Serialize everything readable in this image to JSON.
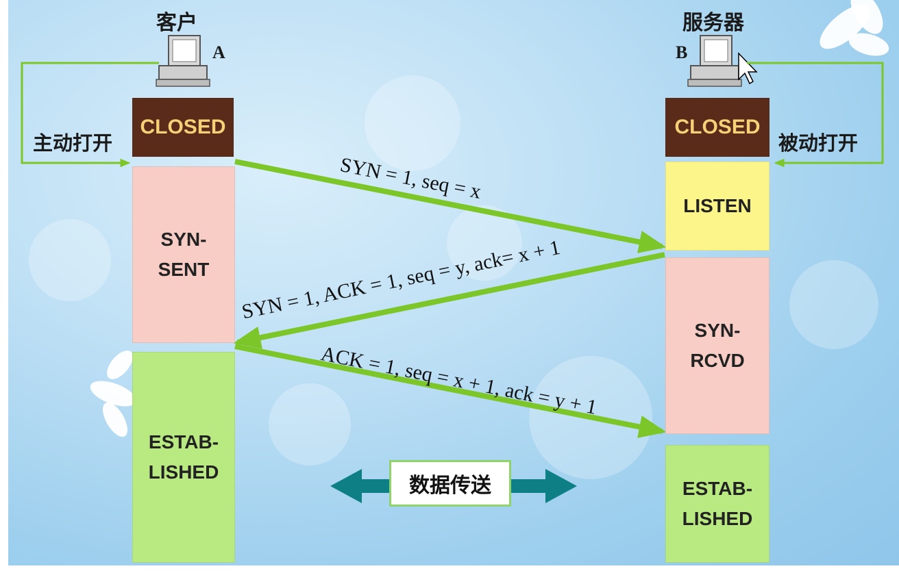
{
  "client": {
    "title": "客户",
    "letter": "A",
    "action": "主动打开"
  },
  "server": {
    "title": "服务器",
    "letter": "B",
    "action": "被动打开"
  },
  "states": {
    "client_closed": "CLOSED",
    "client_syn_sent": "SYN-\nSENT",
    "client_established": "ESTAB-\nLISHED",
    "server_closed": "CLOSED",
    "server_listen": "LISTEN",
    "server_syn_rcvd": "SYN-\nRCVD",
    "server_established": "ESTAB-\nLISHED"
  },
  "messages": {
    "m1": "SYN = 1, seq = x",
    "m2": "SYN = 1, ACK = 1, seq = y, ack= x + 1",
    "m3": "ACK = 1, seq = x + 1, ack = y + 1"
  },
  "data_transfer": "数据传送",
  "colors": {
    "arrow": "#7cc62a",
    "closed_bg": "#5b2b1a",
    "closed_text": "#f6d178",
    "syn_bg": "#f7cdc6",
    "established_bg": "#b9ea82",
    "listen_bg": "#fbf58a",
    "data_arrow": "#0f7f86"
  },
  "icons": [
    "computer-icon",
    "mouse-cursor-icon"
  ]
}
